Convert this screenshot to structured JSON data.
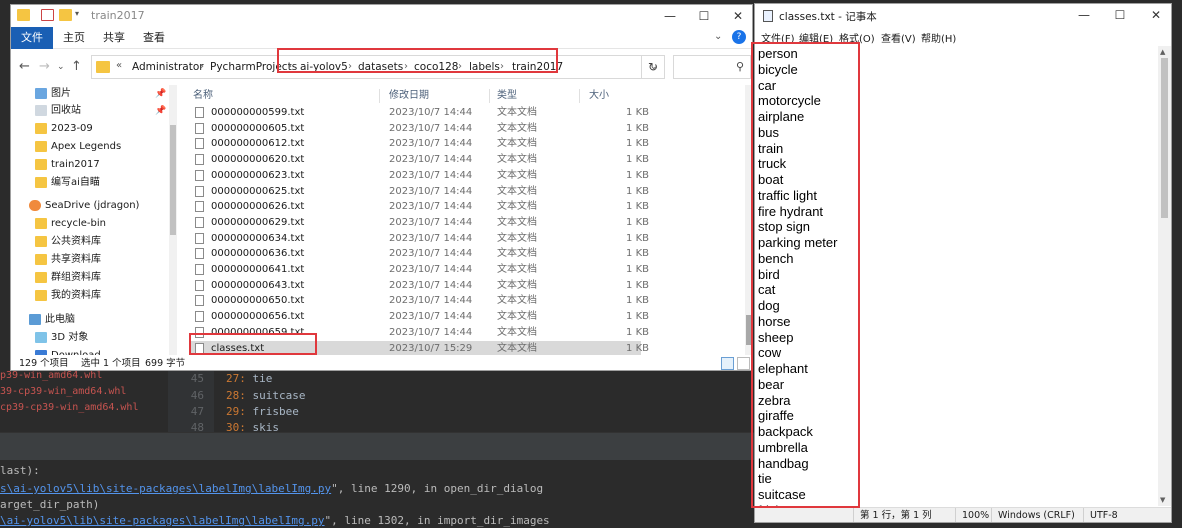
{
  "ide": {
    "whl_lines": [
      "p39-win_amd64.whl",
      "39-cp39-win_amd64.whl",
      "cp39-cp39-win_amd64.whl"
    ],
    "code_lines": [
      {
        "ln": "45",
        "num": "27:",
        "val": "tie"
      },
      {
        "ln": "46",
        "num": "28:",
        "val": "suitcase"
      },
      {
        "ln": "47",
        "num": "29:",
        "val": "frisbee"
      },
      {
        "ln": "48",
        "num": "30:",
        "val": "skis"
      }
    ],
    "terminal": [
      {
        "pre": "last):",
        "link": "",
        "post": ""
      },
      {
        "pre": "",
        "link": "s\\ai-yolov5\\lib\\site-packages\\labelImg\\labelImg.py",
        "post": "\", line 1290, in open_dir_dialog"
      },
      {
        "pre": "arget_dir_path)",
        "link": "",
        "post": ""
      },
      {
        "pre": "",
        "link": "\\ai-yolov5\\lib\\site-packages\\labelImg\\labelImg.py",
        "post": "\", line 1302, in import_dir_images"
      }
    ]
  },
  "explorer": {
    "title": "train2017",
    "ribbon": {
      "file": "文件",
      "tabs": [
        "主页",
        "共享",
        "查看"
      ]
    },
    "address": {
      "prefix": "«",
      "crumbs": [
        "Administrator",
        "PycharmProjects",
        "ai-yolov5",
        "datasets",
        "coco128",
        "labels",
        "train2017"
      ]
    },
    "nav_items": [
      {
        "label": "图片",
        "icon": "pictures-icon",
        "pinned": true
      },
      {
        "label": "回收站",
        "icon": "recycle-bin-icon",
        "pinned": true
      },
      {
        "label": "2023-09",
        "icon": "folder-icon",
        "pinned": false
      },
      {
        "label": "Apex Legends",
        "icon": "folder-icon",
        "pinned": false
      },
      {
        "label": "train2017",
        "icon": "folder-icon",
        "pinned": false
      },
      {
        "label": "编写ai自瞄",
        "icon": "folder-icon",
        "pinned": false
      },
      {
        "label": "SeaDrive (jdragon)",
        "icon": "seadrive-icon",
        "pinned": false
      },
      {
        "label": "recycle-bin",
        "icon": "folder-icon",
        "pinned": false
      },
      {
        "label": "公共资料库",
        "icon": "folder-icon",
        "pinned": false
      },
      {
        "label": "共享资料库",
        "icon": "folder-icon",
        "pinned": false
      },
      {
        "label": "群组资料库",
        "icon": "folder-icon",
        "pinned": false
      },
      {
        "label": "我的资料库",
        "icon": "folder-icon",
        "pinned": false
      },
      {
        "label": "此电脑",
        "icon": "computer-icon",
        "pinned": false
      },
      {
        "label": "3D 对象",
        "icon": "3d-objects-icon",
        "pinned": false
      },
      {
        "label": "Download",
        "icon": "download-icon",
        "pinned": false
      }
    ],
    "columns": {
      "name": "名称",
      "date": "修改日期",
      "type": "类型",
      "size": "大小"
    },
    "files": [
      {
        "name": "000000000599.txt",
        "date": "2023/10/7 14:44",
        "type": "文本文档",
        "size": "1 KB"
      },
      {
        "name": "000000000605.txt",
        "date": "2023/10/7 14:44",
        "type": "文本文档",
        "size": "1 KB"
      },
      {
        "name": "000000000612.txt",
        "date": "2023/10/7 14:44",
        "type": "文本文档",
        "size": "1 KB"
      },
      {
        "name": "000000000620.txt",
        "date": "2023/10/7 14:44",
        "type": "文本文档",
        "size": "1 KB"
      },
      {
        "name": "000000000623.txt",
        "date": "2023/10/7 14:44",
        "type": "文本文档",
        "size": "1 KB"
      },
      {
        "name": "000000000625.txt",
        "date": "2023/10/7 14:44",
        "type": "文本文档",
        "size": "1 KB"
      },
      {
        "name": "000000000626.txt",
        "date": "2023/10/7 14:44",
        "type": "文本文档",
        "size": "1 KB"
      },
      {
        "name": "000000000629.txt",
        "date": "2023/10/7 14:44",
        "type": "文本文档",
        "size": "1 KB"
      },
      {
        "name": "000000000634.txt",
        "date": "2023/10/7 14:44",
        "type": "文本文档",
        "size": "1 KB"
      },
      {
        "name": "000000000636.txt",
        "date": "2023/10/7 14:44",
        "type": "文本文档",
        "size": "1 KB"
      },
      {
        "name": "000000000641.txt",
        "date": "2023/10/7 14:44",
        "type": "文本文档",
        "size": "1 KB"
      },
      {
        "name": "000000000643.txt",
        "date": "2023/10/7 14:44",
        "type": "文本文档",
        "size": "1 KB"
      },
      {
        "name": "000000000650.txt",
        "date": "2023/10/7 14:44",
        "type": "文本文档",
        "size": "1 KB"
      },
      {
        "name": "000000000656.txt",
        "date": "2023/10/7 14:44",
        "type": "文本文档",
        "size": "1 KB"
      },
      {
        "name": "000000000659.txt",
        "date": "2023/10/7 14:44",
        "type": "文本文档",
        "size": "1 KB"
      },
      {
        "name": "classes.txt",
        "date": "2023/10/7 15:29",
        "type": "文本文档",
        "size": "1 KB",
        "selected": true
      }
    ],
    "status": {
      "count": "129 个项目",
      "selected": "选中 1 个项目",
      "size": "699 字节"
    }
  },
  "notepad": {
    "title": "classes.txt - 记事本",
    "menu": [
      "文件(F)",
      "编辑(E)",
      "格式(O)",
      "查看(V)",
      "帮助(H)"
    ],
    "lines": [
      "person",
      "bicycle",
      "car",
      "motorcycle",
      "airplane",
      "bus",
      "train",
      "truck",
      "boat",
      "traffic light",
      "fire hydrant",
      "stop sign",
      "parking meter",
      "bench",
      "bird",
      "cat",
      "dog",
      "horse",
      "sheep",
      "cow",
      "elephant",
      "bear",
      "zebra",
      "giraffe",
      "backpack",
      "umbrella",
      "handbag",
      "tie",
      "suitcase",
      "frisbee"
    ],
    "status": {
      "position": "第 1 行，第 1 列",
      "zoom": "100%",
      "eol": "Windows (CRLF)",
      "encoding": "UTF-8"
    }
  },
  "colors": {
    "highlight": "#e0383d",
    "accent": "#1a5fb4",
    "folder": "#f5c542"
  }
}
